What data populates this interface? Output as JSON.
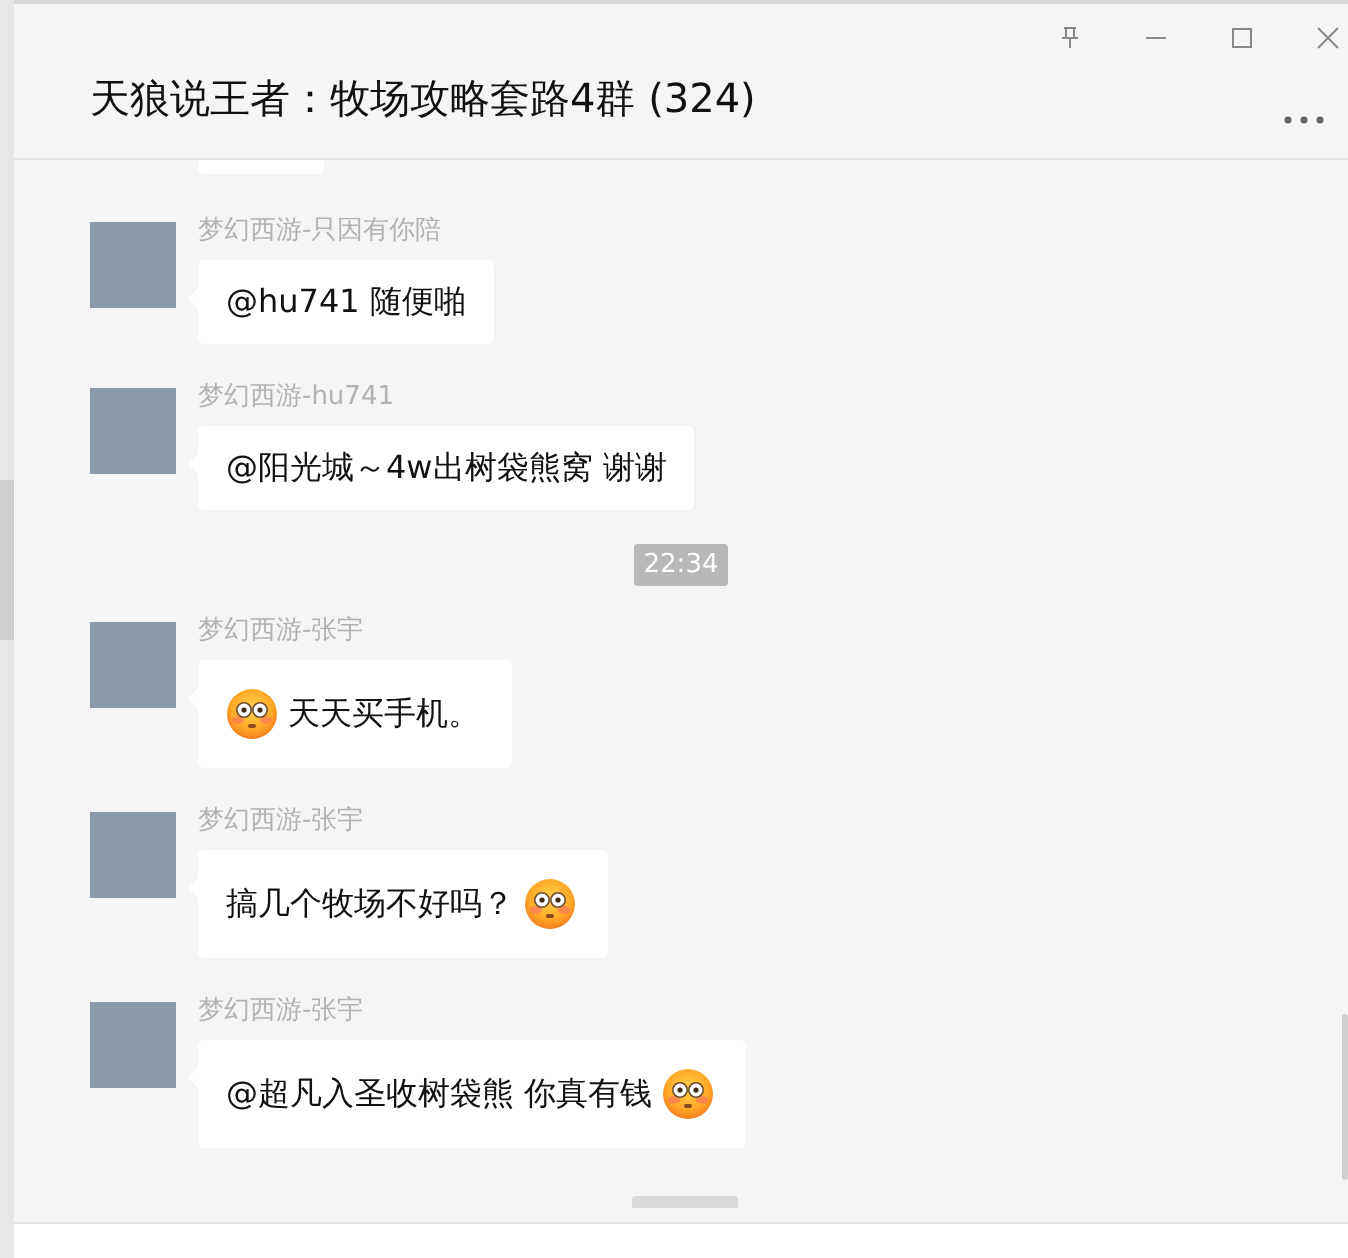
{
  "window": {
    "title": "天狼说王者：牧场攻略套路4群 (324)"
  },
  "messages": [
    {
      "kind": "message",
      "sender": "梦幻西游-只因有你陪",
      "parts": [
        {
          "kind": "text",
          "text": "@hu741 随便啪"
        }
      ]
    },
    {
      "kind": "message",
      "sender": "梦幻西游-hu741",
      "parts": [
        {
          "kind": "text",
          "text": "@阳光城～4w出树袋熊窝 谢谢"
        }
      ]
    },
    {
      "kind": "time",
      "text": "22:34"
    },
    {
      "kind": "message",
      "sender": "梦幻西游-张宇",
      "parts": [
        {
          "kind": "emoji"
        },
        {
          "kind": "text",
          "text": "天天买手机。"
        }
      ]
    },
    {
      "kind": "message",
      "sender": "梦幻西游-张宇",
      "parts": [
        {
          "kind": "text",
          "text": "搞几个牧场不好吗？"
        },
        {
          "kind": "emoji"
        }
      ]
    },
    {
      "kind": "message",
      "sender": "梦幻西游-张宇",
      "parts": [
        {
          "kind": "text",
          "text": "@超凡入圣收树袋熊 你真有钱"
        },
        {
          "kind": "emoji"
        }
      ]
    }
  ]
}
